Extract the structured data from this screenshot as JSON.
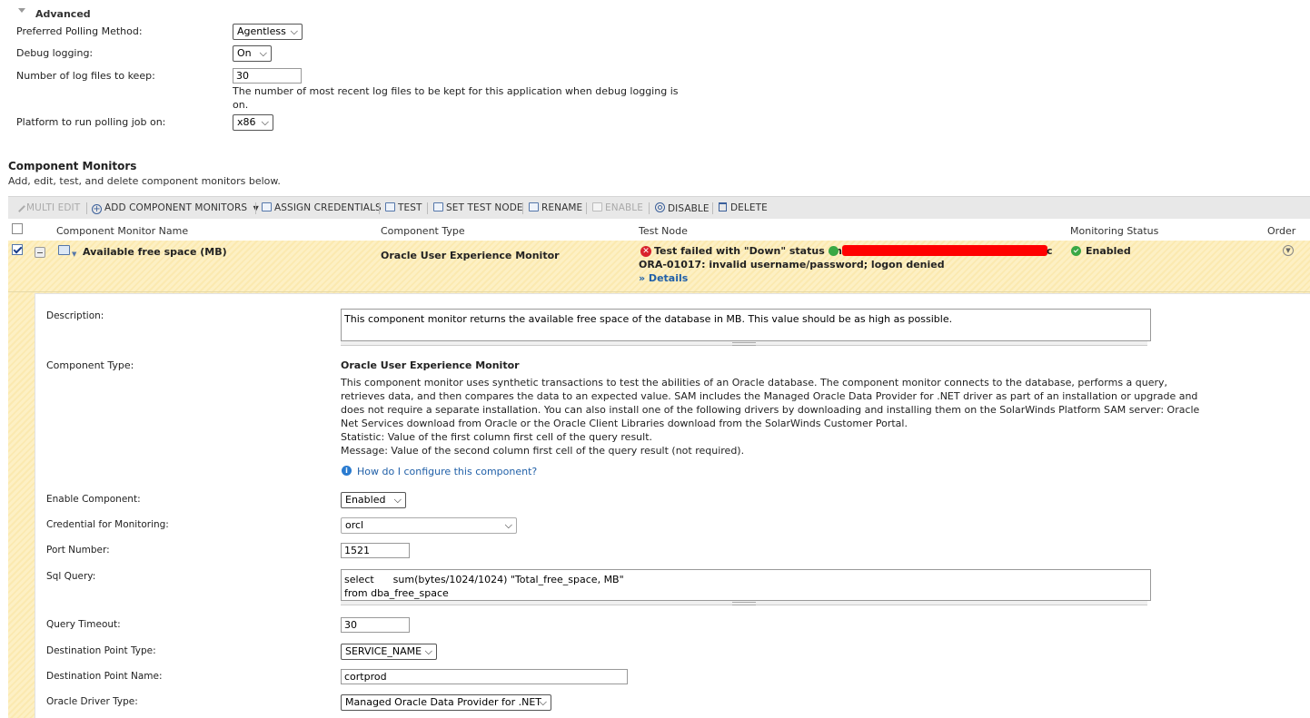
{
  "advanced": {
    "section_title": "Advanced",
    "preferred_polling_label": "Preferred Polling Method:",
    "preferred_polling_value": "Agentless",
    "debug_logging_label": "Debug logging:",
    "debug_logging_value": "On",
    "log_files_label": "Number of log files to keep:",
    "log_files_value": "30",
    "log_files_help_1": "The number of most recent log files to be kept for this application when debug logging is",
    "log_files_help_2": "on.",
    "platform_label": "Platform to run polling job on:",
    "platform_value": "x86"
  },
  "component_monitors": {
    "title": "Component Monitors",
    "subtitle": "Add, edit, test, and delete component monitors below."
  },
  "toolbar": {
    "multi_edit": "MULTI EDIT",
    "add_component_monitors": "ADD COMPONENT MONITORS",
    "assign_credentials": "ASSIGN CREDENTIALS",
    "test": "TEST",
    "set_test_node": "SET TEST NODE",
    "rename": "RENAME",
    "enable": "ENABLE",
    "disable": "DISABLE",
    "delete": "DELETE"
  },
  "table": {
    "headers": {
      "name": "Component Monitor Name",
      "type": "Component Type",
      "test_node": "Test Node",
      "status": "Monitoring Status",
      "order": "Order"
    },
    "row": {
      "name": "Available free space (MB)",
      "type": "Oracle User Experience Monitor",
      "test_status": "Test failed with \"Down\" status on",
      "test_error": "ORA-01017: invalid username/password; logon denied",
      "details_link": "» Details",
      "monitoring_status": "Enabled",
      "node_suffix": "c"
    }
  },
  "details": {
    "description_label": "Description:",
    "description_value": "This component monitor returns the available free space of the database in MB. This value should be as high as possible.",
    "component_type_label": "Component Type:",
    "component_type_title": "Oracle User Experience Monitor",
    "component_type_desc": [
      "This component monitor uses synthetic transactions to test the abilities of an Oracle database. The component monitor connects to the database, performs a query,",
      "retrieves data, and then compares the data to an expected value. SAM includes the Managed Oracle Data Provider for .NET driver as part of an installation or upgrade and",
      "does not require a separate installation. You can also install one of the following drivers by downloading and installing them on the SolarWinds Platform SAM server: Oracle",
      "Net Services download from Oracle or the Oracle Client Libraries download from the SolarWinds Customer Portal.",
      "Statistic: Value of the first column first cell of the query result.",
      "Message: Value of the second column first cell of the query result (not required)."
    ],
    "how_to_link": "How do I configure this component?",
    "enable_component_label": "Enable Component:",
    "enable_component_value": "Enabled",
    "credential_label": "Credential for Monitoring:",
    "credential_value": "orcl",
    "port_label": "Port Number:",
    "port_value": "1521",
    "sql_label": "Sql Query:",
    "sql_line_1": "select      sum(bytes/1024/1024) \"Total_free_space, MB\"",
    "sql_line_2": "from dba_free_space",
    "timeout_label": "Query Timeout:",
    "timeout_value": "30",
    "dest_type_label": "Destination Point Type:",
    "dest_type_value": "SERVICE_NAME",
    "dest_name_label": "Destination Point Name:",
    "dest_name_value": "cortprod",
    "driver_label": "Oracle Driver Type:",
    "driver_value": "Managed Oracle Data Provider for .NET"
  },
  "colors": {
    "selected_row": "#fdf0c4",
    "toolbar_bg": "#e8e8e8",
    "link": "#2160a8",
    "error_red": "#d9232d",
    "ok_green": "#3aa845",
    "redaction": "#ff0000"
  },
  "icons": [
    "collapse-triangle-icon",
    "pencil-icon",
    "plus-circle-icon",
    "credentials-icon",
    "test-icon",
    "set-test-node-icon",
    "rename-icon",
    "enable-icon",
    "disable-icon",
    "trash-icon",
    "error-x-icon",
    "green-dot-icon",
    "check-circle-icon",
    "chevron-down-circle-icon",
    "info-icon",
    "component-icon",
    "collapse-row-icon"
  ]
}
